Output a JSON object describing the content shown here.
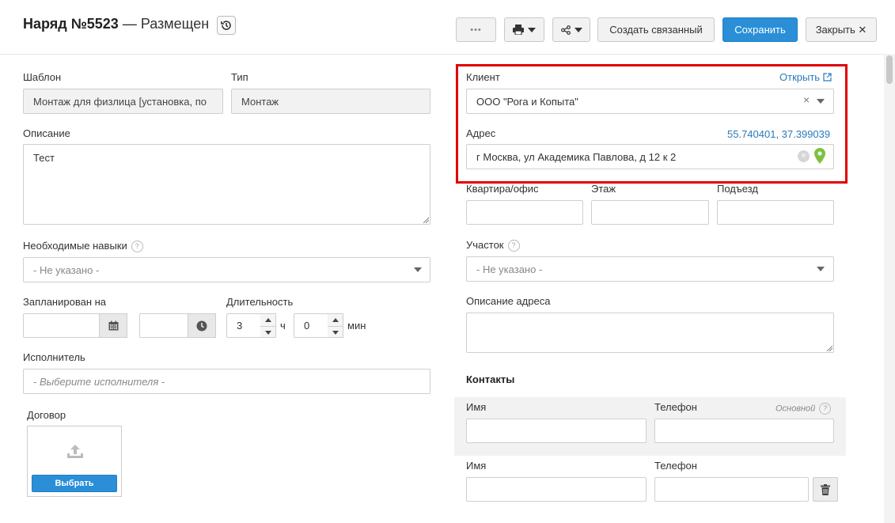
{
  "header": {
    "title_prefix": "Наряд №5523",
    "title_sep": " — ",
    "status": "Размещен",
    "more_label": "•••",
    "create_related_label": "Создать связанный",
    "save_label": "Сохранить",
    "close_label": "Закрыть ✕"
  },
  "left": {
    "template_label": "Шаблон",
    "template_value": "Монтаж для физлица [установка, по",
    "type_label": "Тип",
    "type_value": "Монтаж",
    "description_label": "Описание",
    "description_value": "Тест",
    "skills_label": "Необходимые навыки",
    "skills_value": "- Не указано -",
    "planned_label": "Запланирован на",
    "duration_label": "Длительность",
    "hours_value": "3",
    "hours_unit": "ч",
    "minutes_value": "0",
    "minutes_unit": "мин",
    "executor_label": "Исполнитель",
    "executor_placeholder": "- Выберите исполнителя -",
    "contract_label": "Договор",
    "choose_label": "Выбрать"
  },
  "right": {
    "client_label": "Клиент",
    "open_link": "Открыть",
    "client_value": "ООО \"Рога и Копыта\"",
    "address_label": "Адрес",
    "coordinates": "55.740401, 37.399039",
    "address_value": "г Москва, ул Академика Павлова, д 12 к 2",
    "apartment_label": "Квартира/офис",
    "floor_label": "Этаж",
    "entrance_label": "Подъезд",
    "area_label": "Участок",
    "area_value": "- Не указано -",
    "address_desc_label": "Описание адреса",
    "contacts_title": "Контакты",
    "contacts": [
      {
        "name_label": "Имя",
        "phone_label": "Телефон",
        "primary_label": "Основной"
      },
      {
        "name_label": "Имя",
        "phone_label": "Телефон"
      }
    ]
  },
  "colors": {
    "accent": "#2a8fd7",
    "highlight": "#e00000",
    "link": "#2a7ab8",
    "pin": "#7cc242"
  }
}
